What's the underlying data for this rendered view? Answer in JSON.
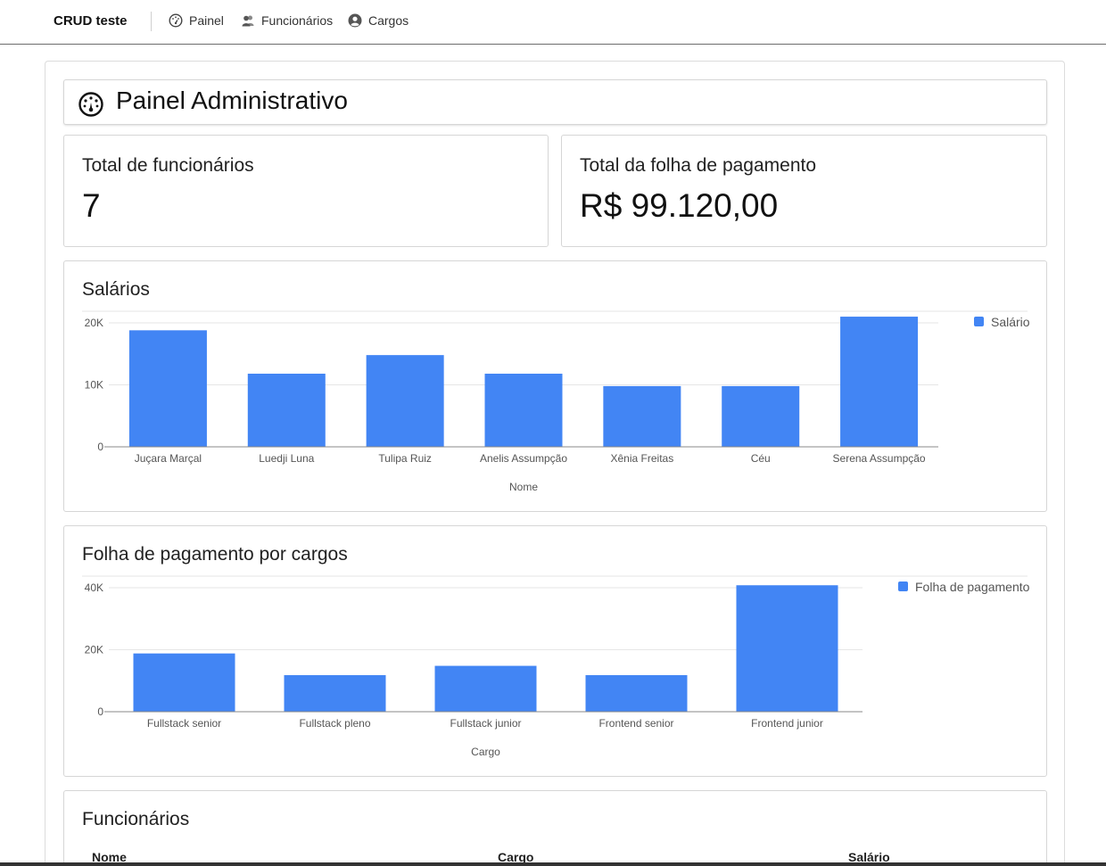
{
  "nav": {
    "brand": "CRUD teste",
    "links": [
      {
        "label": "Painel",
        "icon": "dashboard-icon"
      },
      {
        "label": "Funcionários",
        "icon": "users-icon"
      },
      {
        "label": "Cargos",
        "icon": "user-circle-icon"
      }
    ]
  },
  "page": {
    "title": "Painel Administrativo"
  },
  "stats": {
    "employees": {
      "label": "Total de funcionários",
      "value": "7"
    },
    "payroll": {
      "label": "Total da folha de pagamento",
      "value": "R$ 99.120,00"
    }
  },
  "colors": {
    "bar": "#4285f4",
    "grid": "#e6e6e6",
    "axis": "#555555",
    "text": "#555555"
  },
  "chart_data": [
    {
      "type": "bar",
      "title": "Salários",
      "xlabel": "Nome",
      "ylabel": "",
      "ylim": [
        0,
        20000
      ],
      "yticks": [
        "0",
        "10K",
        "20K"
      ],
      "categories": [
        "Juçara Marçal",
        "Luedji Luna",
        "Tulipa Ruiz",
        "Anelis Assumpção",
        "Xênia Freitas",
        "Céu",
        "Serena Assumpção"
      ],
      "series": [
        {
          "name": "Salário",
          "values": [
            18800,
            11800,
            14800,
            11800,
            9800,
            9800,
            21000
          ]
        }
      ],
      "legend": "top-right",
      "grid": true
    },
    {
      "type": "bar",
      "title": "Folha de pagamento por cargos",
      "xlabel": "Cargo",
      "ylabel": "",
      "ylim": [
        0,
        40000
      ],
      "yticks": [
        "0",
        "20K",
        "40K"
      ],
      "categories": [
        "Fullstack senior",
        "Fullstack pleno",
        "Fullstack junior",
        "Frontend senior",
        "Frontend junior"
      ],
      "series": [
        {
          "name": "Folha de pagamento",
          "values": [
            18800,
            11800,
            14800,
            11800,
            40800
          ]
        }
      ],
      "legend": "top-right",
      "grid": true
    }
  ],
  "table": {
    "title": "Funcionários",
    "columns": [
      "Nome",
      "Cargo",
      "Salário"
    ]
  }
}
